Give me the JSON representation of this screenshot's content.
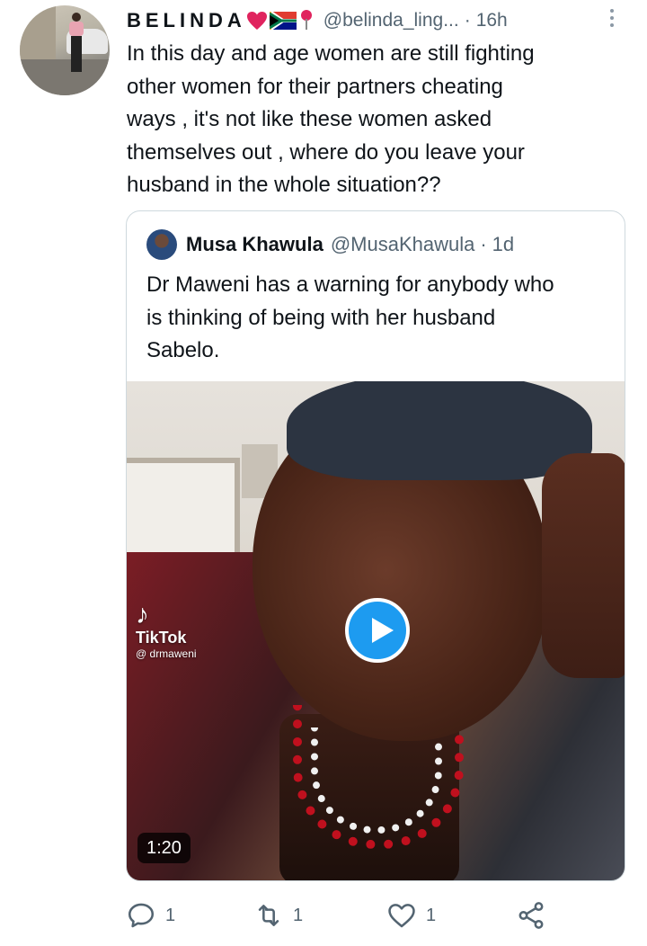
{
  "tweet": {
    "author_name": "BELINDA",
    "author_emoji": [
      "red-heart",
      "south-africa-flag",
      "round-pushpin"
    ],
    "handle": "@belinda_ling...",
    "time": "16h",
    "separator": "·",
    "text": "In this day and age women are still fighting\nother women for their partners cheating\nways , it's not like these women asked\nthemselves out , where do you leave your\nhusband in the whole situation??"
  },
  "quoted_tweet": {
    "author_name": "Musa Khawula",
    "handle": "@MusaKhawula",
    "separator": "·",
    "time": "1d",
    "text": "Dr Maweni has a warning for anybody who\nis thinking of being with her husband\nSabelo.",
    "media": {
      "watermark_brand": "TikTok",
      "watermark_user": "@ drmaweni",
      "duration": "1:20",
      "play_icon": "play-icon"
    }
  },
  "actions": {
    "reply_count": "1",
    "retweet_count": "1",
    "like_count": "1"
  },
  "colors": {
    "text_primary": "#0f1419",
    "text_secondary": "#536471",
    "accent": "#1d9bf0",
    "border": "#cfd9de"
  }
}
